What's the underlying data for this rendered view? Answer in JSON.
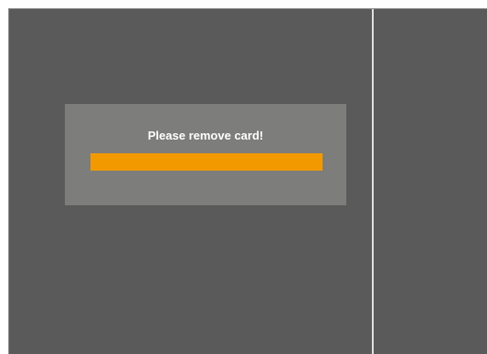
{
  "dialog": {
    "message": "Please remove card!",
    "progress": 1.0
  },
  "colors": {
    "background": "#5a5a5a",
    "dialog_background": "#7d7d7b",
    "divider": "#e0e0e0",
    "progress_fill": "#f29900",
    "message_text": "#ffffff"
  }
}
